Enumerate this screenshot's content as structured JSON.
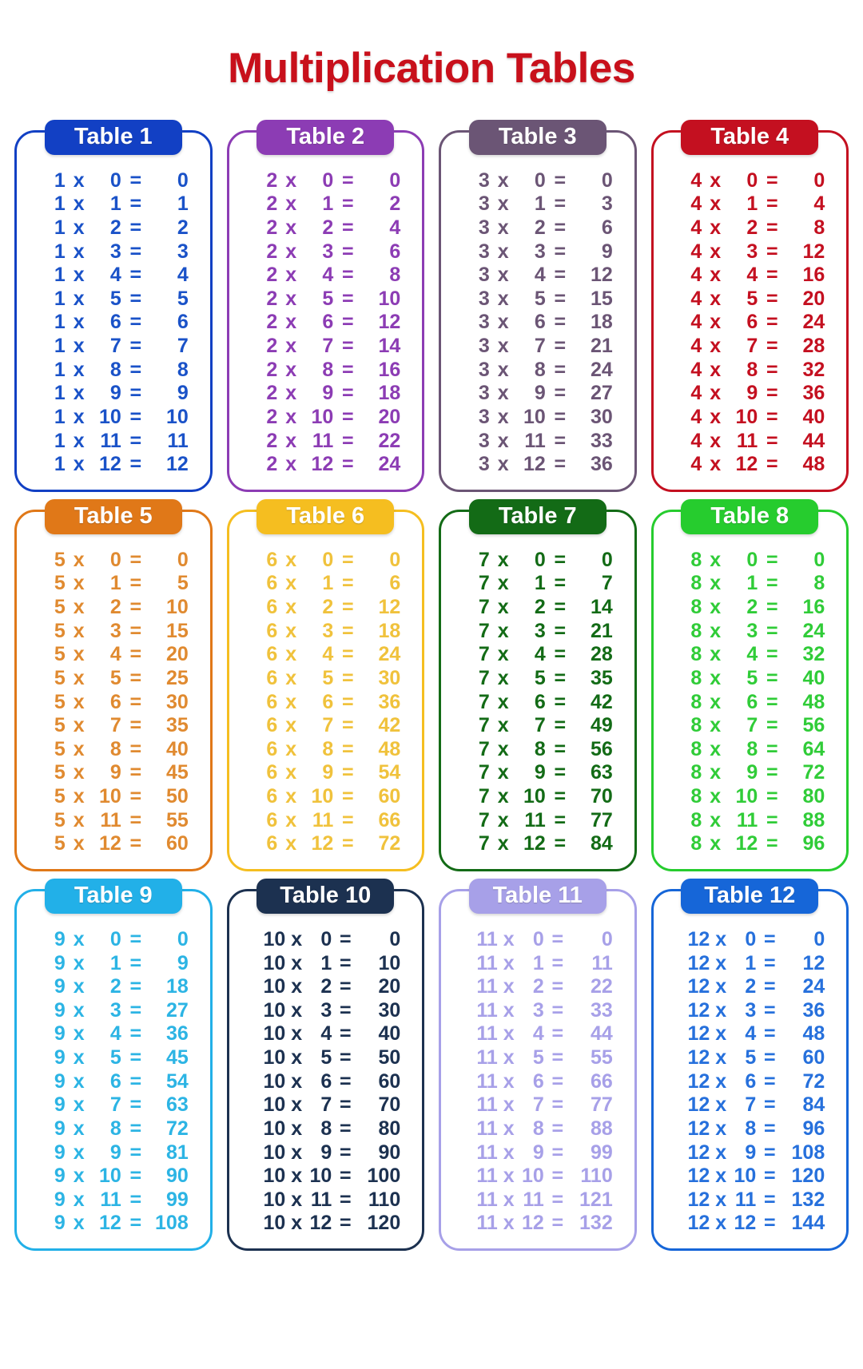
{
  "header": {
    "title": "Multiplication Tables",
    "title_color": "#c8101b"
  },
  "tables": [
    {
      "label": "Table 1",
      "color": "#1240c4",
      "text_color": "#1a52c8",
      "tone": "dark",
      "wide": false,
      "multiplicand": "1",
      "times": "x",
      "equals": "=",
      "multipliers": [
        "0",
        "1",
        "2",
        "3",
        "4",
        "5",
        "6",
        "7",
        "8",
        "9",
        "10",
        "11",
        "12"
      ],
      "results": [
        "0",
        "1",
        "2",
        "3",
        "4",
        "5",
        "6",
        "7",
        "8",
        "9",
        "10",
        "11",
        "12"
      ]
    },
    {
      "label": "Table 2",
      "color": "#8c3cb4",
      "text_color": "#8c3cb4",
      "tone": "dark",
      "wide": false,
      "multiplicand": "2",
      "times": "x",
      "equals": "=",
      "multipliers": [
        "0",
        "1",
        "2",
        "3",
        "4",
        "5",
        "6",
        "7",
        "8",
        "9",
        "10",
        "11",
        "12"
      ],
      "results": [
        "0",
        "2",
        "4",
        "6",
        "8",
        "10",
        "12",
        "14",
        "16",
        "18",
        "20",
        "22",
        "24"
      ]
    },
    {
      "label": "Table 3",
      "color": "#6b5575",
      "text_color": "#6b5575",
      "tone": "dark",
      "wide": false,
      "multiplicand": "3",
      "times": "x",
      "equals": "=",
      "multipliers": [
        "0",
        "1",
        "2",
        "3",
        "4",
        "5",
        "6",
        "7",
        "8",
        "9",
        "10",
        "11",
        "12"
      ],
      "results": [
        "0",
        "3",
        "6",
        "9",
        "12",
        "15",
        "18",
        "21",
        "24",
        "27",
        "30",
        "33",
        "36"
      ]
    },
    {
      "label": "Table 4",
      "color": "#c41020",
      "text_color": "#c41020",
      "tone": "dark",
      "wide": false,
      "multiplicand": "4",
      "times": "x",
      "equals": "=",
      "multipliers": [
        "0",
        "1",
        "2",
        "3",
        "4",
        "5",
        "6",
        "7",
        "8",
        "9",
        "10",
        "11",
        "12"
      ],
      "results": [
        "0",
        "4",
        "8",
        "12",
        "16",
        "20",
        "24",
        "28",
        "32",
        "36",
        "40",
        "44",
        "48"
      ]
    },
    {
      "label": "Table 5",
      "color": "#e07818",
      "text_color": "#e08a30",
      "tone": "dark",
      "wide": false,
      "multiplicand": "5",
      "times": "x",
      "equals": "=",
      "multipliers": [
        "0",
        "1",
        "2",
        "3",
        "4",
        "5",
        "6",
        "7",
        "8",
        "9",
        "10",
        "11",
        "12"
      ],
      "results": [
        "0",
        "5",
        "10",
        "15",
        "20",
        "25",
        "30",
        "35",
        "40",
        "45",
        "50",
        "55",
        "60"
      ]
    },
    {
      "label": "Table 6",
      "color": "#f5be20",
      "text_color": "#f0c23c",
      "tone": "light",
      "wide": false,
      "multiplicand": "6",
      "times": "x",
      "equals": "=",
      "multipliers": [
        "0",
        "1",
        "2",
        "3",
        "4",
        "5",
        "6",
        "7",
        "8",
        "9",
        "10",
        "11",
        "12"
      ],
      "results": [
        "0",
        "6",
        "12",
        "18",
        "24",
        "30",
        "36",
        "42",
        "48",
        "54",
        "60",
        "66",
        "72"
      ]
    },
    {
      "label": "Table 7",
      "color": "#136b16",
      "text_color": "#136b16",
      "tone": "dark",
      "wide": false,
      "multiplicand": "7",
      "times": "x",
      "equals": "=",
      "multipliers": [
        "0",
        "1",
        "2",
        "3",
        "4",
        "5",
        "6",
        "7",
        "8",
        "9",
        "10",
        "11",
        "12"
      ],
      "results": [
        "0",
        "7",
        "14",
        "21",
        "28",
        "35",
        "42",
        "49",
        "56",
        "63",
        "70",
        "77",
        "84"
      ]
    },
    {
      "label": "Table 8",
      "color": "#26cc2e",
      "text_color": "#30cc38",
      "tone": "light",
      "wide": false,
      "multiplicand": "8",
      "times": "x",
      "equals": "=",
      "multipliers": [
        "0",
        "1",
        "2",
        "3",
        "4",
        "5",
        "6",
        "7",
        "8",
        "9",
        "10",
        "11",
        "12"
      ],
      "results": [
        "0",
        "8",
        "16",
        "24",
        "32",
        "40",
        "48",
        "56",
        "64",
        "72",
        "80",
        "88",
        "96"
      ]
    },
    {
      "label": "Table 9",
      "color": "#22b0e8",
      "text_color": "#2cb4e4",
      "tone": "light",
      "wide": false,
      "multiplicand": "9",
      "times": "x",
      "equals": "=",
      "multipliers": [
        "0",
        "1",
        "2",
        "3",
        "4",
        "5",
        "6",
        "7",
        "8",
        "9",
        "10",
        "11",
        "12"
      ],
      "results": [
        "0",
        "9",
        "18",
        "27",
        "36",
        "45",
        "54",
        "63",
        "72",
        "81",
        "90",
        "99",
        "108"
      ]
    },
    {
      "label": "Table 10",
      "color": "#1c3150",
      "text_color": "#1c3150",
      "tone": "dark",
      "wide": true,
      "multiplicand": "10",
      "times": "x",
      "equals": "=",
      "multipliers": [
        "0",
        "1",
        "2",
        "3",
        "4",
        "5",
        "6",
        "7",
        "8",
        "9",
        "10",
        "11",
        "12"
      ],
      "results": [
        "0",
        "10",
        "20",
        "30",
        "40",
        "50",
        "60",
        "70",
        "80",
        "90",
        "100",
        "110",
        "120"
      ]
    },
    {
      "label": "Table 11",
      "color": "#a7a0e8",
      "text_color": "#a7a0e8",
      "tone": "light",
      "wide": true,
      "multiplicand": "11",
      "times": "x",
      "equals": "=",
      "multipliers": [
        "0",
        "1",
        "2",
        "3",
        "4",
        "5",
        "6",
        "7",
        "8",
        "9",
        "10",
        "11",
        "12"
      ],
      "results": [
        "0",
        "11",
        "22",
        "33",
        "44",
        "55",
        "66",
        "77",
        "88",
        "99",
        "110",
        "121",
        "132"
      ]
    },
    {
      "label": "Table 12",
      "color": "#1666d8",
      "text_color": "#2670dc",
      "tone": "dark",
      "wide": true,
      "multiplicand": "12",
      "times": "x",
      "equals": "=",
      "multipliers": [
        "0",
        "1",
        "2",
        "3",
        "4",
        "5",
        "6",
        "7",
        "8",
        "9",
        "10",
        "11",
        "12"
      ],
      "results": [
        "0",
        "12",
        "24",
        "36",
        "48",
        "60",
        "72",
        "84",
        "96",
        "108",
        "120",
        "132",
        "144"
      ]
    }
  ]
}
